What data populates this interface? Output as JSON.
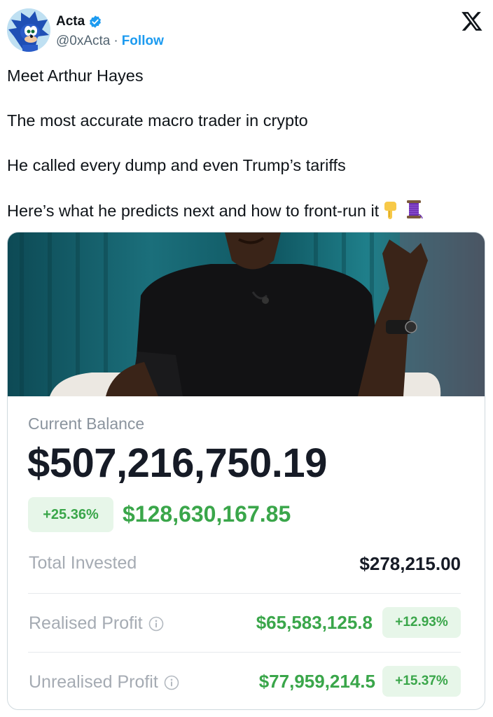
{
  "header": {
    "display_name": "Acta",
    "handle": "@0xActa",
    "separator": "·",
    "follow_label": "Follow"
  },
  "tweet": {
    "lines": [
      "Meet Arthur Hayes",
      "The most accurate macro trader in crypto",
      "He called every dump and even Trump’s tariffs",
      "Here’s what he predicts next and how to front-run it"
    ],
    "emojis": [
      "pointing-down-hand-icon",
      "thread-spool-icon"
    ]
  },
  "card": {
    "balance_label": "Current Balance",
    "balance_value": "$507,216,750.19",
    "gain_percent": "+25.36%",
    "gain_amount": "$128,630,167.85",
    "rows": [
      {
        "label": "Total Invested",
        "value": "$278,215.00"
      },
      {
        "label": "Realised Profit",
        "value": "$65,583,125.8",
        "percent": "+12.93%"
      },
      {
        "label": "Unrealised Profit",
        "value": "$77,959,214.5",
        "percent": "+15.37%"
      }
    ]
  },
  "colors": {
    "accent_blue": "#1d9bf0",
    "profit_green": "#3aa64a",
    "profit_badge_bg": "#e7f6e9",
    "muted_label": "#a5abb3"
  }
}
